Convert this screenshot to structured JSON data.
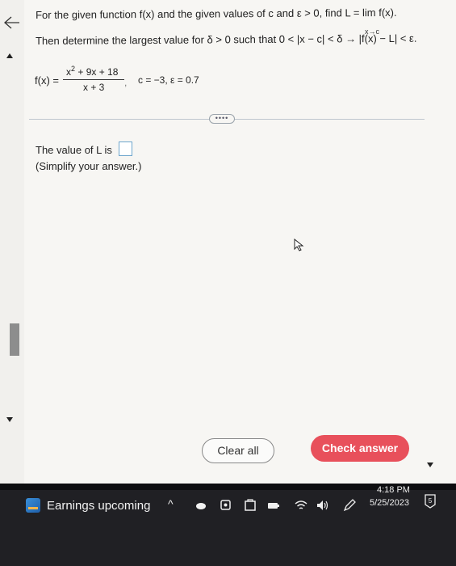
{
  "question": {
    "line1": "For the given function f(x) and the given values of c and ε > 0, find L = lim f(x).",
    "limit_sub": "x→c",
    "line2": "Then determine the largest value for δ > 0 such that 0 < |x − c| < δ → |f(x) − L| < ε."
  },
  "function": {
    "lhs": "f(x) =",
    "numerator_base": "x",
    "numerator_exp": "2",
    "numerator_rest": " + 9x + 18",
    "denominator": "x + 3",
    "comma": ",",
    "params": "c = −3,  ε = 0.7"
  },
  "more_button": "••••",
  "answer": {
    "prompt": "The value of L is",
    "hint": "(Simplify your answer.)"
  },
  "buttons": {
    "clear": "Clear all",
    "check": "Check answer"
  },
  "taskbar": {
    "widget_text": "Earnings upcoming",
    "tray_caret": "^",
    "time": "4:18 PM",
    "date": "5/25/2023",
    "notification_count": "5"
  },
  "colors": {
    "check_button": "#e8505b",
    "taskbar": "#202024"
  }
}
